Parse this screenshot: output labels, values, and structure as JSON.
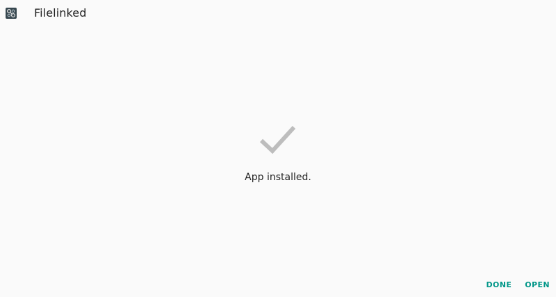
{
  "header": {
    "app_icon": "filelinked-app-icon",
    "title": "Filelinked"
  },
  "main": {
    "status_icon": "checkmark-icon",
    "status_icon_color": "#bdbdbd",
    "status_text": "App installed."
  },
  "actions": {
    "done_label": "DONE",
    "open_label": "OPEN",
    "accent_color": "#009688"
  }
}
